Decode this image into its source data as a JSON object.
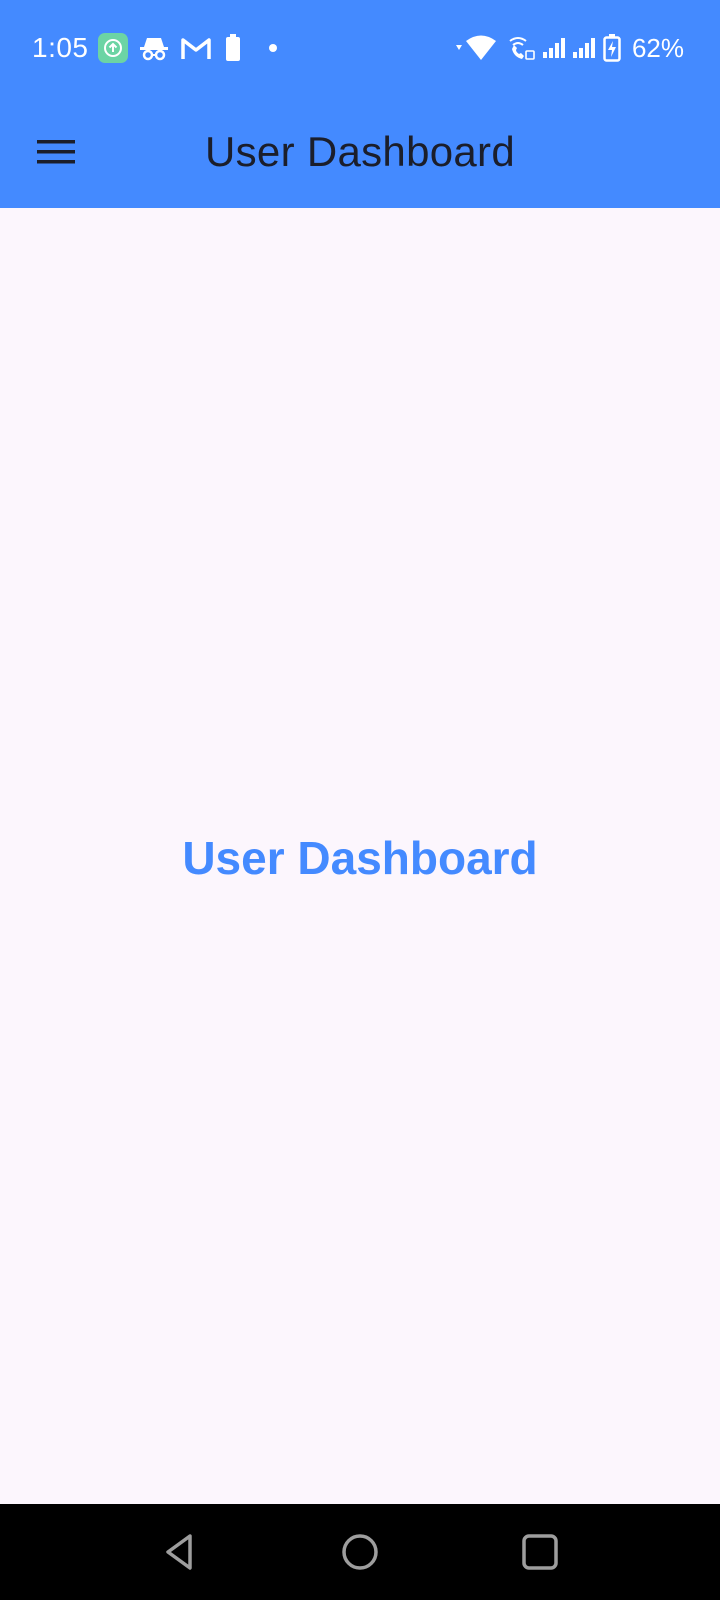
{
  "status_bar": {
    "time": "1:05",
    "battery_percent": "62%",
    "left_icons": [
      "upload-app-icon",
      "incognito-icon",
      "gmail-icon",
      "battery-small-icon",
      "dot-icon"
    ],
    "right_icons": [
      "wifi-icon",
      "wifi-calling-icon",
      "signal-icon",
      "signal-icon",
      "battery-charging-icon"
    ],
    "upload_icon_color": "#6cd4a4"
  },
  "app_bar": {
    "title": "User Dashboard",
    "menu_icon": "menu-icon",
    "background": "#448aff"
  },
  "main": {
    "heading": "User Dashboard",
    "heading_color": "#448aff",
    "background": "#fcf6fd"
  },
  "nav_bar": {
    "buttons": [
      "back-icon",
      "home-icon",
      "recents-icon"
    ]
  }
}
